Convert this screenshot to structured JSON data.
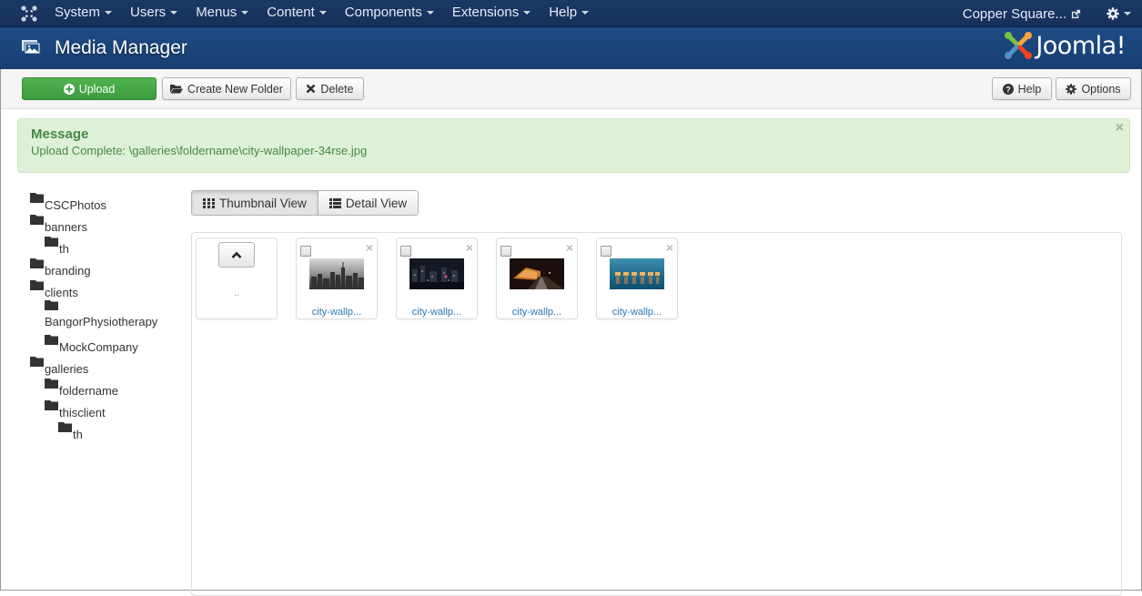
{
  "navbar": {
    "menu": [
      {
        "label": "System"
      },
      {
        "label": "Users"
      },
      {
        "label": "Menus"
      },
      {
        "label": "Content"
      },
      {
        "label": "Components"
      },
      {
        "label": "Extensions"
      },
      {
        "label": "Help"
      }
    ],
    "site_link": "Copper Square...",
    "icons": {
      "brand": "joomla-icon",
      "external": "external-link-icon",
      "settings": "gear-icon"
    }
  },
  "header": {
    "title": "Media Manager",
    "logo_text": "Joomla!"
  },
  "toolbar": {
    "upload_label": "Upload",
    "create_folder_label": "Create New Folder",
    "delete_label": "Delete",
    "help_label": "Help",
    "options_label": "Options"
  },
  "alert": {
    "heading": "Message",
    "text": "Upload Complete: \\galleries\\foldername\\city-wallpaper-34rse.jpg",
    "close": "×",
    "colors": {
      "background": "#dff0d8",
      "text": "#468847"
    }
  },
  "folder_tree": [
    {
      "label": "CSCPhotos",
      "level": 0
    },
    {
      "label": "banners",
      "level": 0
    },
    {
      "label": "th",
      "level": 1
    },
    {
      "label": "branding",
      "level": 0
    },
    {
      "label": "clients",
      "level": 0
    },
    {
      "label": "BangorPhysiotherapy",
      "level": 1
    },
    {
      "label": "MockCompany",
      "level": 1
    },
    {
      "label": "galleries",
      "level": 0
    },
    {
      "label": "foldername",
      "level": 1
    },
    {
      "label": "thisclient",
      "level": 1
    },
    {
      "label": "th",
      "level": 2
    }
  ],
  "view_toggle": {
    "thumbnail_label": "Thumbnail View",
    "detail_label": "Detail View",
    "active": "thumbnail"
  },
  "files": {
    "parent_label": "..",
    "items": [
      {
        "name": "city-wallp...",
        "theme": "grayscale skyline"
      },
      {
        "name": "city-wallp...",
        "theme": "night city lights"
      },
      {
        "name": "city-wallp...",
        "theme": "night road"
      },
      {
        "name": "city-wallp...",
        "theme": "waterfront dusk"
      }
    ],
    "remove_glyph": "×"
  },
  "colors": {
    "navbar": "#17305a",
    "header": "#1d4b84",
    "upload_button": "#46a546",
    "link": "#2a79b6"
  }
}
